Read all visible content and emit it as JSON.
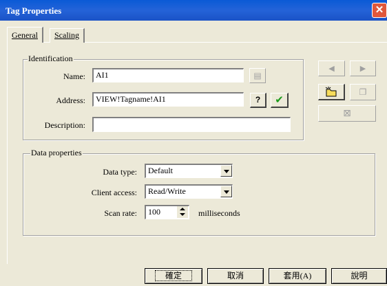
{
  "window": {
    "title": "Tag Properties",
    "close_glyph": "✕"
  },
  "tabs": [
    {
      "label": "General"
    },
    {
      "label": "Scaling"
    }
  ],
  "identification": {
    "group_label": "Identification",
    "name_label": "Name:",
    "name_value": "AI1",
    "address_label": "Address:",
    "address_value": "VIEW!Tagname!AI1",
    "question_label": "?",
    "check_glyph": "✔",
    "description_label": "Description:",
    "description_value": ""
  },
  "data_properties": {
    "group_label": "Data properties",
    "data_type_label": "Data type:",
    "data_type_value": "Default",
    "client_access_label": "Client access:",
    "client_access_value": "Read/Write",
    "scan_rate_label": "Scan rate:",
    "scan_rate_value": "100",
    "scan_rate_unit": "milliseconds"
  },
  "side_buttons": {
    "prev_glyph": "◀",
    "next_glyph": "▶",
    "delete_glyph": "⊠"
  },
  "buttons": {
    "ok": "確定",
    "cancel": "取消",
    "apply": "套用(A)",
    "help": "說明"
  }
}
